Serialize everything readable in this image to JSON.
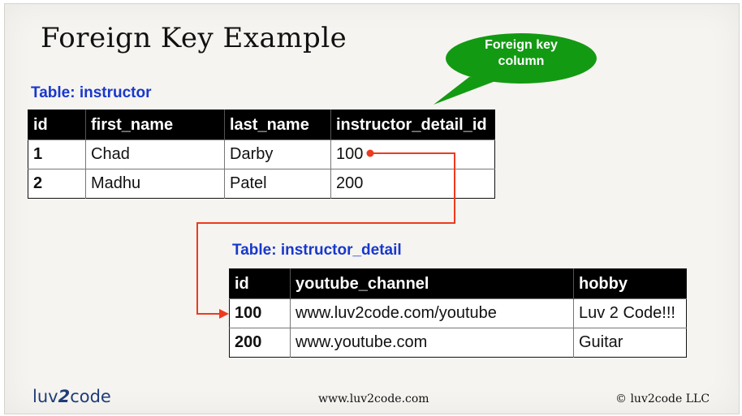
{
  "title": "Foreign Key Example",
  "callout": {
    "line1": "Foreign key",
    "line2": "column",
    "color": "#139a13"
  },
  "instructor_table": {
    "label": "Table: instructor",
    "columns": [
      "id",
      "first_name",
      "last_name",
      "instructor_detail_id"
    ],
    "rows": [
      [
        "1",
        "Chad",
        "Darby",
        "100"
      ],
      [
        "2",
        "Madhu",
        "Patel",
        "200"
      ]
    ]
  },
  "detail_table": {
    "label": "Table: instructor_detail",
    "columns": [
      "id",
      "youtube_channel",
      "hobby"
    ],
    "rows": [
      [
        "100",
        "www.luv2code.com/youtube",
        "Luv 2 Code!!!"
      ],
      [
        "200",
        "www.youtube.com",
        "Guitar"
      ]
    ]
  },
  "connector_color": "#ee3a1f",
  "label_color": "#1838cc",
  "footer": {
    "logo_left": "luv",
    "logo_mid": "2",
    "logo_right": "code",
    "url": "www.luv2code.com",
    "copyright": "© luv2code LLC"
  }
}
